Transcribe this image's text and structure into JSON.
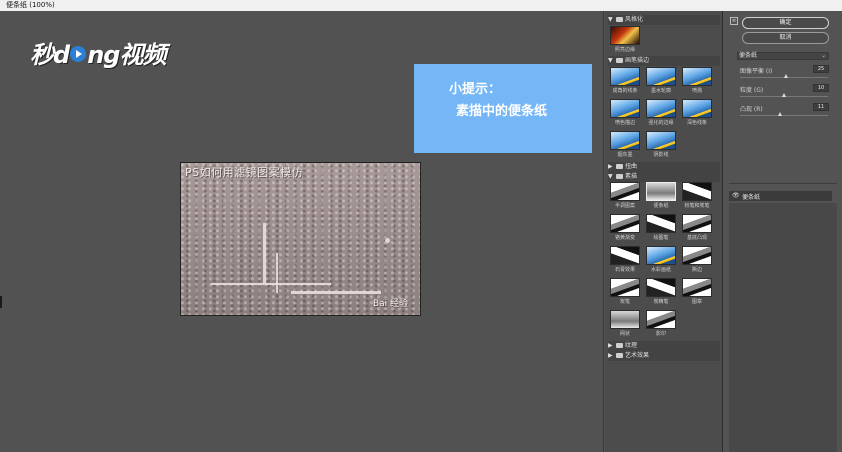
{
  "window": {
    "title": "便条纸 (100%)"
  },
  "logo": {
    "pre": "秒",
    "mid": "d",
    "post": "ng视频"
  },
  "tip": {
    "title": "小提示：",
    "body": "素描中的便条纸"
  },
  "canvas": {
    "caption": "PS如何用滤镜图案模仿",
    "watermark": "Bai 经验"
  },
  "gallery": {
    "categories": [
      {
        "name": "风格化",
        "expanded": true
      },
      {
        "name": "画笔描边",
        "expanded": true
      },
      {
        "name": "扭曲",
        "expanded": false
      },
      {
        "name": "素描",
        "expanded": true
      },
      {
        "name": "纹理",
        "expanded": false
      },
      {
        "name": "艺术效果",
        "expanded": false
      }
    ],
    "stylize": [
      "照亮边缘"
    ],
    "brush": [
      "成角的线条",
      "墨水轮廓",
      "喷溅",
      "喷色描边",
      "强化的边缘",
      "深色线条",
      "烟灰墨",
      "阴影线"
    ],
    "sketch": [
      "半调图案",
      "便条纸",
      "粉笔和炭笔",
      "铬黄渐变",
      "绘图笔",
      "基底凸现",
      "石膏效果",
      "水彩画纸",
      "撕边",
      "炭笔",
      "炭精笔",
      "图章",
      "网状",
      "影印"
    ]
  },
  "props": {
    "help": "≡",
    "ok": "确定",
    "cancel": "取消",
    "filter": "便条纸",
    "params": [
      {
        "label": "图像平衡 (I)",
        "value": "25",
        "level": 0.52
      },
      {
        "label": "粒度 (G)",
        "value": "10",
        "level": 0.5
      },
      {
        "label": "凸现 (R)",
        "value": "11",
        "level": 0.45
      }
    ],
    "layer": "便条纸"
  }
}
